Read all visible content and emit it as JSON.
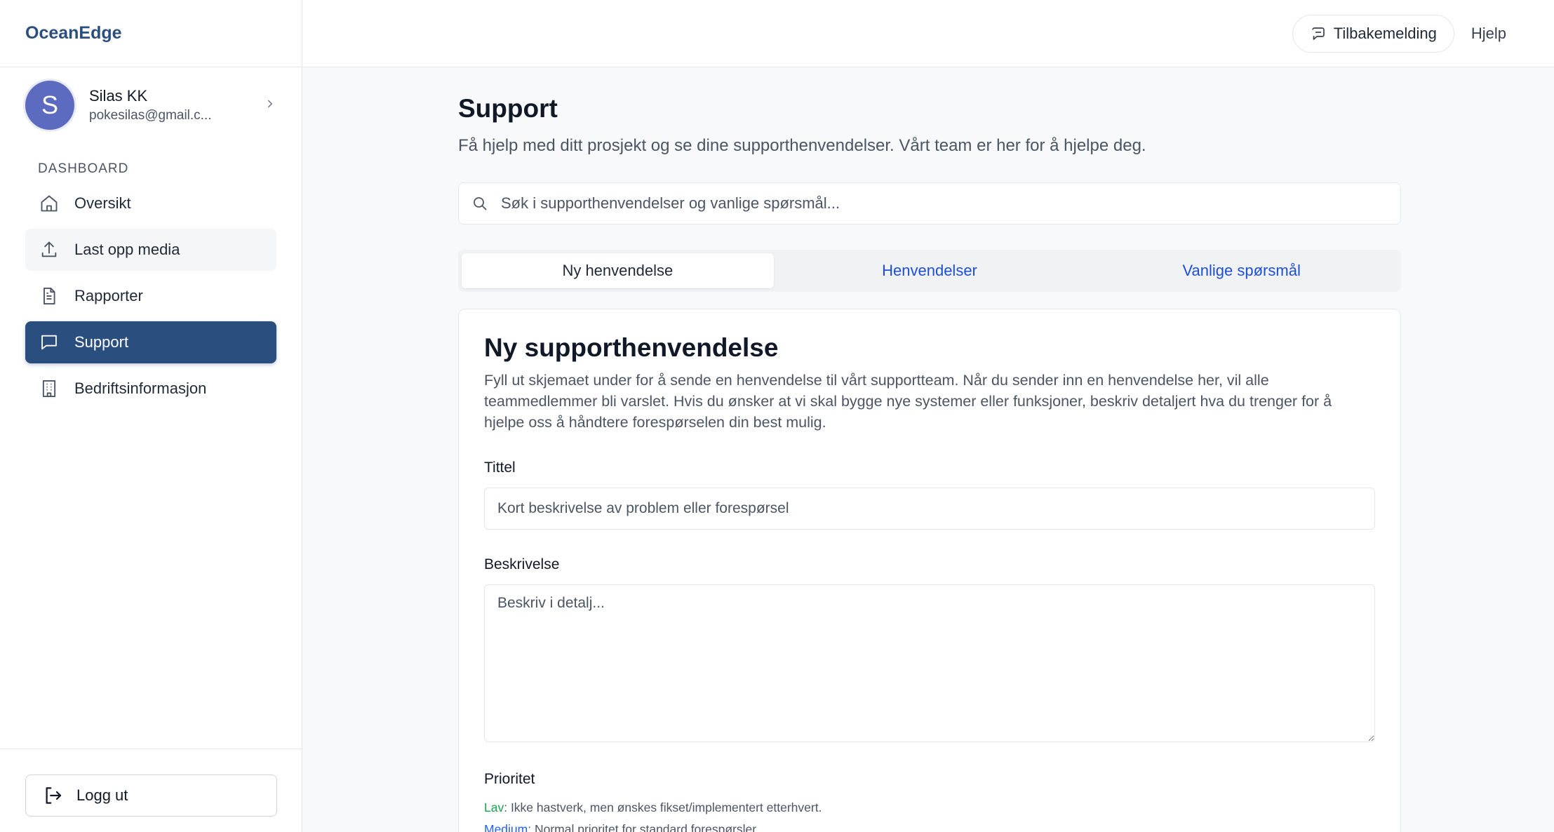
{
  "brand": "OceanEdge",
  "user": {
    "initial": "S",
    "name": "Silas KK",
    "email": "pokesilas@gmail.c..."
  },
  "sidebar": {
    "section_label": "DASHBOARD",
    "items": [
      {
        "label": "Oversikt",
        "icon": "home-icon"
      },
      {
        "label": "Last opp media",
        "icon": "upload-icon"
      },
      {
        "label": "Rapporter",
        "icon": "document-icon"
      },
      {
        "label": "Support",
        "icon": "message-icon"
      },
      {
        "label": "Bedriftsinformasjon",
        "icon": "building-icon"
      }
    ],
    "logout_label": "Logg ut"
  },
  "topbar": {
    "feedback_label": "Tilbakemelding",
    "help_label": "Hjelp"
  },
  "page": {
    "title": "Support",
    "subtitle": "Få hjelp med ditt prosjekt og se dine supporthenvendelser. Vårt team er her for å hjelpe deg."
  },
  "search": {
    "placeholder": "Søk i supporthenvendelser og vanlige spørsmål..."
  },
  "tabs": [
    "Ny henvendelse",
    "Henvendelser",
    "Vanlige spørsmål"
  ],
  "form": {
    "title": "Ny supporthenvendelse",
    "description": "Fyll ut skjemaet under for å sende en henvendelse til vårt supportteam. Når du sender inn en henvendelse her, vil alle teammedlemmer bli varslet. Hvis du ønsker at vi skal bygge nye systemer eller funksjoner, beskriv detaljert hva du trenger for å hjelpe oss å håndtere forespørselen din best mulig.",
    "title_label": "Tittel",
    "title_placeholder": "Kort beskrivelse av problem eller forespørsel",
    "desc_label": "Beskrivelse",
    "desc_placeholder": "Beskriv i detalj...",
    "priority_label": "Prioritet",
    "priority_low_name": "Lav",
    "priority_low_text": ": Ikke hastverk, men ønskes fikset/implementert etterhvert.",
    "priority_med_name": "Medium",
    "priority_med_text": ": Normal prioritet for standard forespørsler."
  },
  "colors": {
    "brand": "#2a4f7f",
    "active_nav": "#2a4f7f",
    "tab_link": "#1d4ed8",
    "priority_low": "#16a34a",
    "priority_medium": "#2563eb"
  }
}
